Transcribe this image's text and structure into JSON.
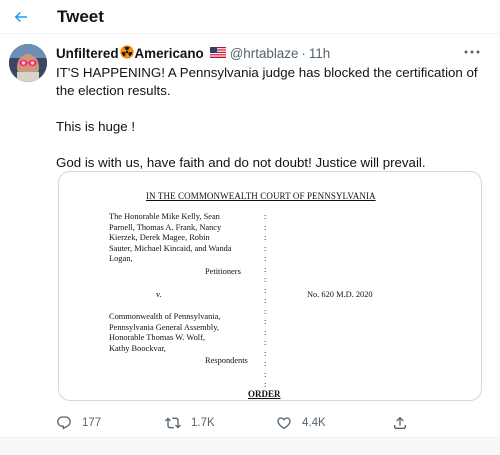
{
  "header": {
    "title": "Tweet",
    "back_icon": "arrow-left-icon"
  },
  "tweet": {
    "display_name": "Unfiltered",
    "display_name_suffix": "Americano",
    "name_emojis": [
      "radioactive-icon",
      "us-flag-icon"
    ],
    "handle": "@hrtablaze",
    "separator": "·",
    "time": "11h",
    "paragraphs": [
      "IT'S HAPPENING! A Pennsylvania judge has blocked the certification of the election results.",
      "This is huge !",
      "God is with us, have faith and do not doubt! Justice will prevail."
    ]
  },
  "document": {
    "heading": "IN THE COMMONWEALTH COURT OF PENNSYLVANIA",
    "petitioner_lines": [
      "The Honorable Mike Kelly, Sean",
      "Parnell, Thomas A. Frank, Nancy",
      "Kierzek, Derek Magee, Robin",
      "Sauter, Michael Kincaid, and Wanda",
      "Logan,"
    ],
    "petitioners_label": "Petitioners",
    "versus": "v.",
    "docket": "No. 620 M.D. 2020",
    "respondent_lines": [
      "Commonwealth of Pennsylvania,",
      "Pennsylvania General Assembly,",
      "Honorable Thomas W. Wolf,",
      "Kathy Boockvar,"
    ],
    "respondents_label": "Respondents",
    "order_label": "ORDER"
  },
  "actions": {
    "reply_count": "177",
    "retweet_count": "1.7K",
    "like_count": "4.4K"
  },
  "colors": {
    "accent": "#1d9bf0",
    "text": "#0f1419",
    "muted": "#536471",
    "border": "#eff3f4"
  }
}
